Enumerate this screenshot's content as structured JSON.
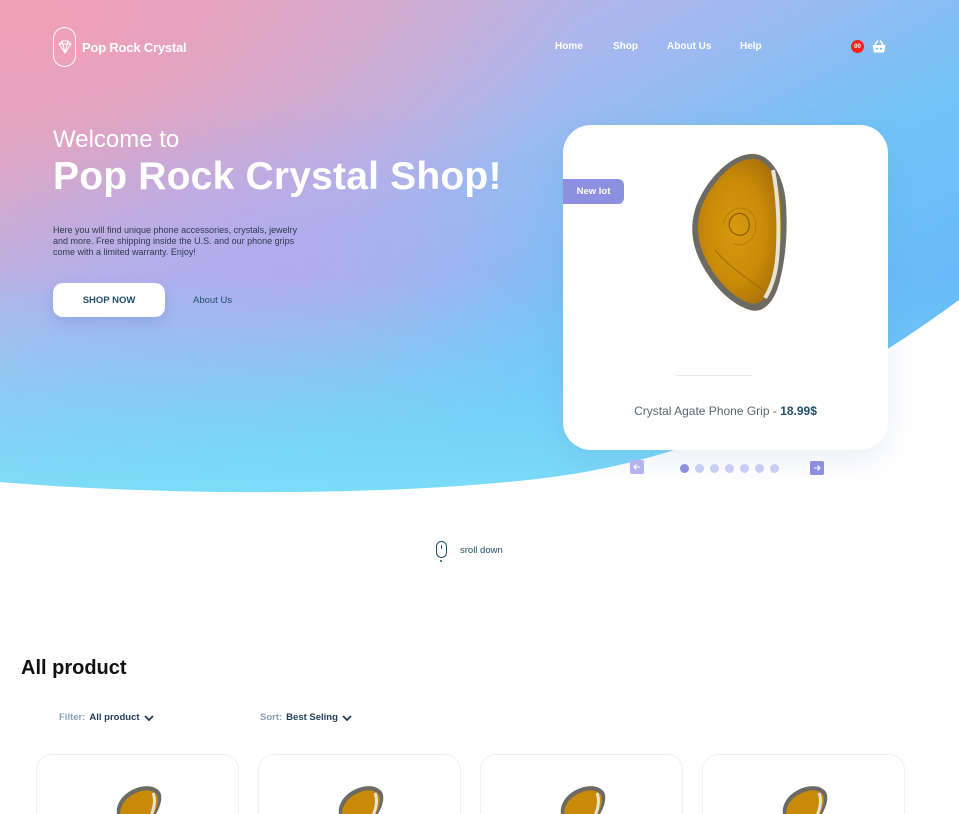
{
  "header": {
    "logo_text": "Pop Rock Crystal",
    "nav": [
      "Home",
      "Shop",
      "About Us",
      "Help"
    ],
    "cart_count": "00"
  },
  "hero": {
    "welcome": "Welcome to",
    "headline": "Pop Rock Crystal Shop!",
    "intro": "Here you will find unique phone accessories, crystals, jewelry and more. Free shipping inside the U.S. and our phone grips come with a limited warranty. Enjoy!",
    "shop_now_label": "SHOP NOW",
    "about_label": "About Us"
  },
  "featured": {
    "badge": "New lot",
    "name": "Crystal Agate Phone Grip - ",
    "price": "18.99$",
    "slide_count": 7,
    "active_slide": 1
  },
  "scroll": {
    "label": "sroll down"
  },
  "products": {
    "title": "All product",
    "filter_label": "Filter:",
    "filter_value": "All product",
    "sort_label": "Sort:",
    "sort_value": "Best Seling"
  },
  "colors": {
    "accent": "#8d8fe0",
    "text_dark": "#1f4e6b",
    "badge_red": "#ff1f1f"
  }
}
